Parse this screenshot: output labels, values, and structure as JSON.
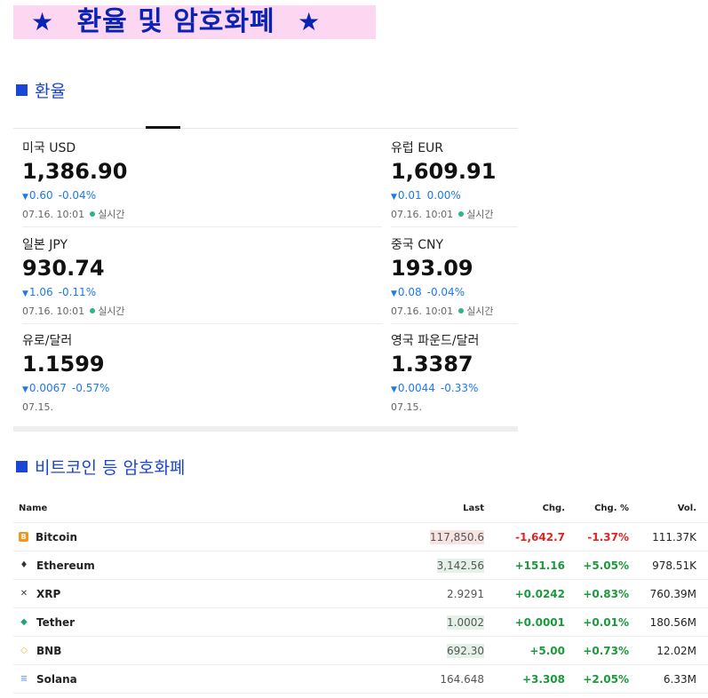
{
  "banner": {
    "star_left": "★",
    "title": "환율 및 암호화폐",
    "star_right": "★"
  },
  "fx_section": {
    "title": "환율",
    "cards": [
      {
        "name": "미국 USD",
        "value": "1,386.90",
        "change": "0.60",
        "pct": "-0.04%",
        "date": "07.16. 10:01",
        "realtime": "실시간"
      },
      {
        "name": "유럽 EUR",
        "value": "1,609.91",
        "change": "0.01",
        "pct": "0.00%",
        "date": "07.16. 10:01",
        "realtime": "실시간"
      },
      {
        "name": "일본 JPY",
        "value": "930.74",
        "change": "1.06",
        "pct": "-0.11%",
        "date": "07.16. 10:01",
        "realtime": "실시간"
      },
      {
        "name": "중국 CNY",
        "value": "193.09",
        "change": "0.08",
        "pct": "-0.04%",
        "date": "07.16. 10:01",
        "realtime": "실시간"
      },
      {
        "name": "유로/달러",
        "value": "1.1599",
        "change": "0.0067",
        "pct": "-0.57%",
        "date": "07.15.",
        "realtime": ""
      },
      {
        "name": "영국 파운드/달러",
        "value": "1.3387",
        "change": "0.0044",
        "pct": "-0.33%",
        "date": "07.15.",
        "realtime": ""
      }
    ],
    "down_symbol": "▼"
  },
  "crypto_section": {
    "title": "비트코인 등 암호화폐",
    "headers": {
      "name": "Name",
      "last": "Last",
      "chg": "Chg.",
      "pct": "Chg. %",
      "vol": "Vol."
    },
    "rows": [
      {
        "icon": "bitcoin-icon",
        "glyph": "B",
        "name": "Bitcoin",
        "last": "117,850.6",
        "chg": "-1,642.7",
        "pct": "-1.37%",
        "vol": "111.37K",
        "direction": "down",
        "last_bg": "#f7e3e1"
      },
      {
        "icon": "ethereum-icon",
        "glyph": "♦",
        "name": "Ethereum",
        "last": "3,142.56",
        "chg": "+151.16",
        "pct": "+5.05%",
        "vol": "978.51K",
        "direction": "up",
        "last_bg": "#e5f1e8"
      },
      {
        "icon": "xrp-icon",
        "glyph": "✕",
        "name": "XRP",
        "last": "2.9291",
        "chg": "+0.0242",
        "pct": "+0.83%",
        "vol": "760.39M",
        "direction": "up",
        "last_bg": "#ffffff"
      },
      {
        "icon": "tether-icon",
        "glyph": "◆",
        "name": "Tether",
        "last": "1.0002",
        "chg": "+0.0001",
        "pct": "+0.01%",
        "vol": "180.56M",
        "direction": "up",
        "last_bg": "#e5f1e8"
      },
      {
        "icon": "bnb-icon",
        "glyph": "◇",
        "name": "BNB",
        "last": "692.30",
        "chg": "+5.00",
        "pct": "+0.73%",
        "vol": "12.02M",
        "direction": "up",
        "last_bg": "#e5f1e8"
      },
      {
        "icon": "solana-icon",
        "glyph": "≡",
        "name": "Solana",
        "last": "164.648",
        "chg": "+3.308",
        "pct": "+2.05%",
        "vol": "6.33M",
        "direction": "up",
        "last_bg": "#ffffff"
      }
    ]
  },
  "colors": {
    "up": "#1a9a3a",
    "down": "#e02424",
    "accent": "#1a46d6",
    "banner_bg": "#fdd6f1",
    "banner_text": "#0a23b4",
    "fx_change": "#1e78f0",
    "realtime_dot": "#2cb48a"
  }
}
